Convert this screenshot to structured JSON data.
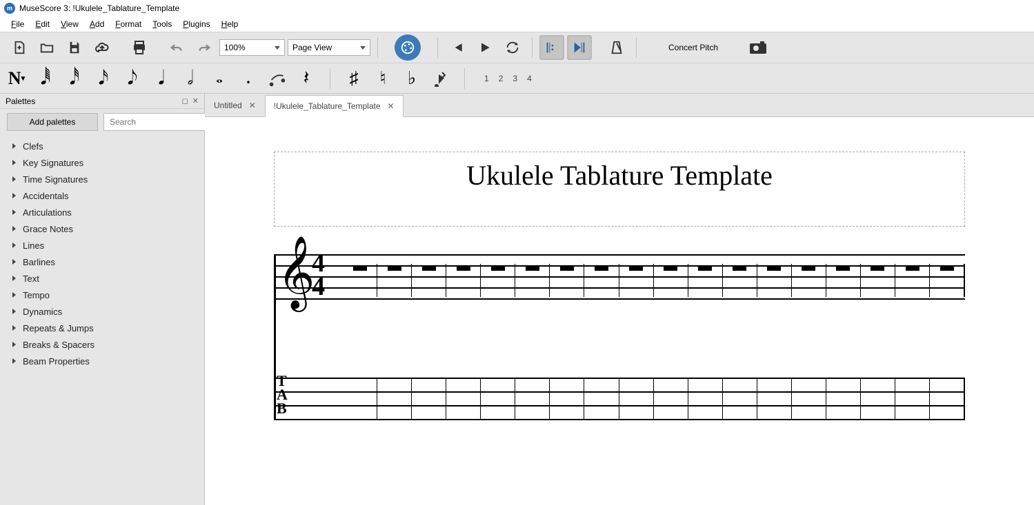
{
  "title": {
    "app": "MuseScore 3",
    "doc": "!Ukulele_Tablature_Template"
  },
  "menu": [
    "File",
    "Edit",
    "View",
    "Add",
    "Format",
    "Tools",
    "Plugins",
    "Help"
  ],
  "toolbar": {
    "zoom": "100%",
    "view_mode": "Page View",
    "concert_pitch": "Concert Pitch"
  },
  "voices": [
    "1",
    "2",
    "3",
    "4"
  ],
  "panel": {
    "title": "Palettes",
    "add_label": "Add palettes",
    "search_placeholder": "Search",
    "items": [
      "Clefs",
      "Key Signatures",
      "Time Signatures",
      "Accidentals",
      "Articulations",
      "Grace Notes",
      "Lines",
      "Barlines",
      "Text",
      "Tempo",
      "Dynamics",
      "Repeats & Jumps",
      "Breaks & Spacers",
      "Beam Properties"
    ]
  },
  "tabs": [
    {
      "label": "Untitled",
      "active": false
    },
    {
      "label": "!Ukulele_Tablature_Template",
      "active": true
    }
  ],
  "score": {
    "title": "Ukulele Tablature Template",
    "time_sig_num": "4",
    "time_sig_den": "4",
    "tab_letters": [
      "T",
      "A",
      "B"
    ],
    "measures": 18
  }
}
